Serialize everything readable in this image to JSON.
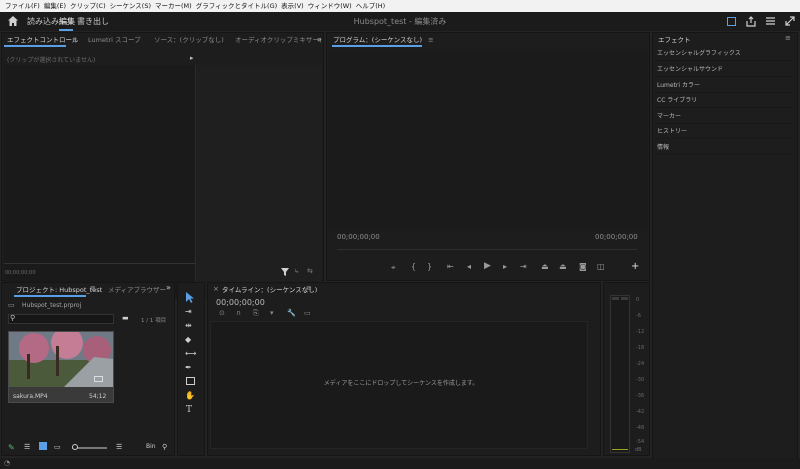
{
  "menu": [
    "ファイル(F)",
    "編集(E)",
    "クリップ(C)",
    "シーケンス(S)",
    "マーカー(M)",
    "グラフィックとタイトル(G)",
    "表示(V)",
    "ウィンドウ(W)",
    "ヘルプ(H)"
  ],
  "workspace": {
    "tabs": [
      "読み込み",
      "編集",
      "書き出し"
    ],
    "active": "編集",
    "doc_title": "Hubspot_test - 編集済み"
  },
  "source_panel": {
    "tabs": [
      "エフェクトコントロール",
      "Lumetri スコープ",
      "ソース：(クリップなし)",
      "オーディオクリップミキサー："
    ],
    "no_clip_text": "(クリップが選択されていません)",
    "timecode": "00;00;00;00"
  },
  "program_panel": {
    "title": "プログラム：(シーケンスなし)",
    "timecode_left": "00;00;00;00",
    "timecode_right": "00;00;00;00"
  },
  "effects_panel": {
    "title": "エフェクト",
    "items": [
      "エッセンシャルグラフィックス",
      "エッセンシャルサウンド",
      "Lumetri カラー",
      "CC ライブラリ",
      "マーカー",
      "ヒストリー",
      "情報"
    ]
  },
  "project_panel": {
    "tabs": [
      "プロジェクト: Hubspot_test",
      "メディアブラウザー"
    ],
    "file": "Hubspot_test.prproj",
    "item_count": "1 / 1 項目",
    "clip_name": "sakura.MP4",
    "clip_duration": "54;12"
  },
  "timeline_panel": {
    "title": "タイムライン：(シーケンスなし)",
    "timecode": "00;00;00;00",
    "drop_hint": "メディアをここにドロップしてシーケンスを作成します。"
  },
  "audio_meter": {
    "ticks": [
      "0",
      "-6",
      "-12",
      "-18",
      "-24",
      "-30",
      "-36",
      "-42",
      "-48",
      "-54",
      "dB"
    ]
  }
}
